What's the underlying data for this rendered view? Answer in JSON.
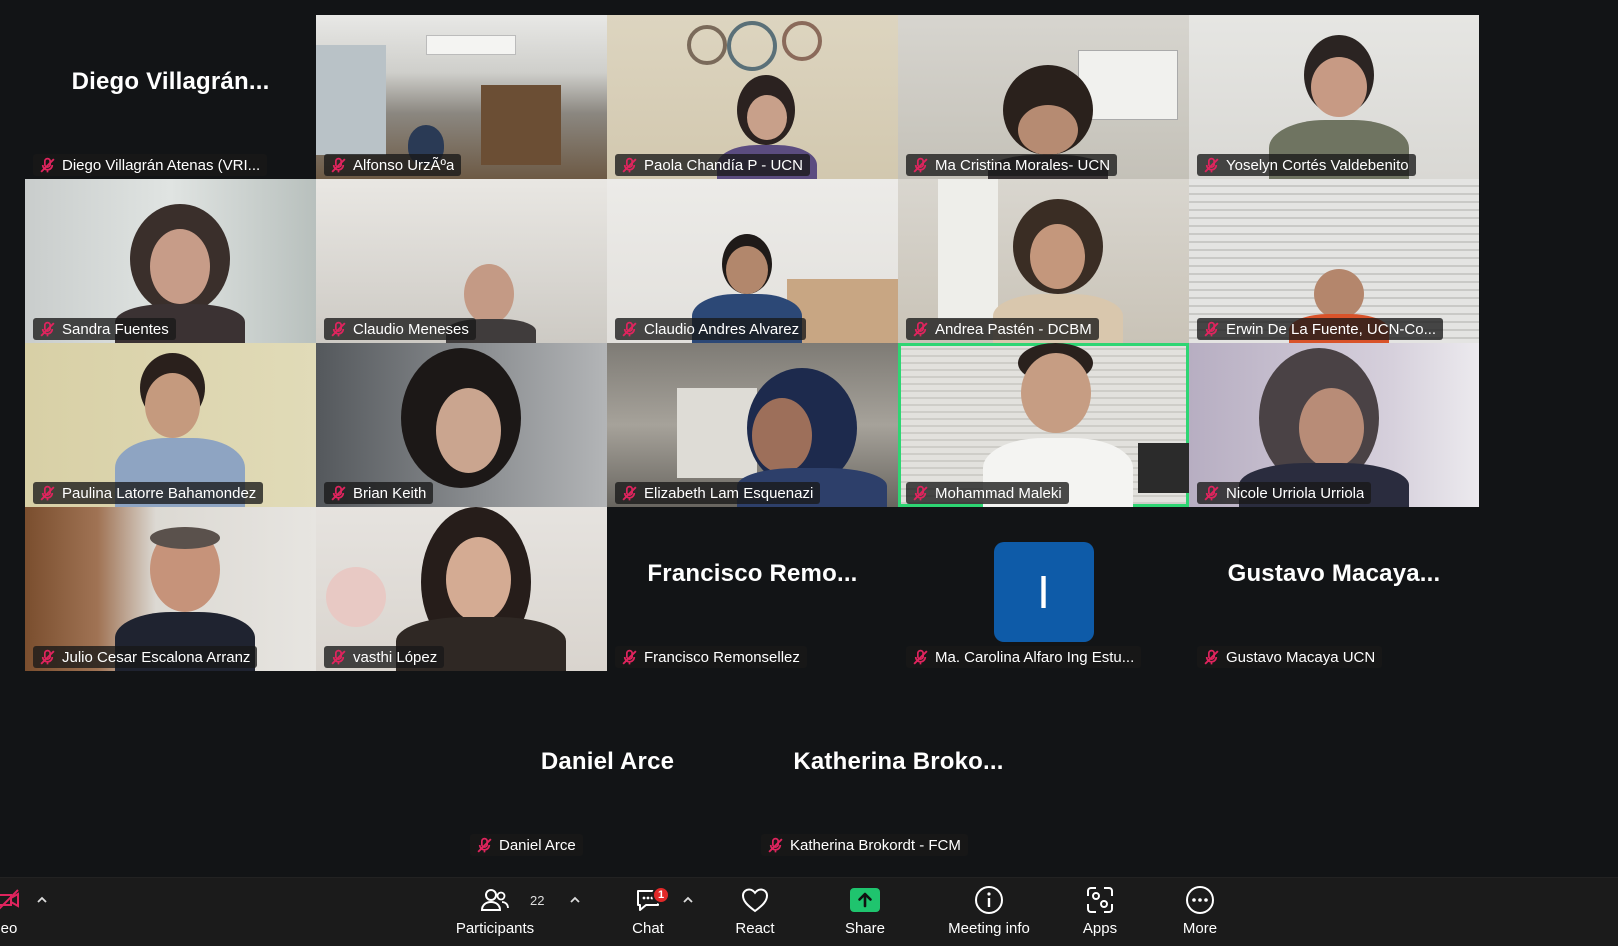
{
  "meeting": {
    "tiles": [
      {
        "name": "Diego Villagrán Atenas (VRI...",
        "display_name": "Diego  Villagrán...",
        "mic_muted": true,
        "video": false
      },
      {
        "name": "Alfonso UrzÃºa",
        "mic_muted": true,
        "video": true
      },
      {
        "name": "Paola Chandía P - UCN",
        "mic_muted": true,
        "video": true
      },
      {
        "name": "Ma Cristina Morales- UCN",
        "mic_muted": true,
        "video": true
      },
      {
        "name": "Yoselyn Cortés Valdebenito",
        "mic_muted": true,
        "video": true
      },
      {
        "name": "Sandra Fuentes",
        "mic_muted": true,
        "video": true
      },
      {
        "name": "Claudio Meneses",
        "mic_muted": true,
        "video": true
      },
      {
        "name": "Claudio Andres Alvarez",
        "mic_muted": true,
        "video": true
      },
      {
        "name": "Andrea Pastén - DCBM",
        "mic_muted": true,
        "video": true
      },
      {
        "name": "Erwin De La Fuente, UCN-Co...",
        "mic_muted": true,
        "video": true
      },
      {
        "name": "Paulina Latorre Bahamondez",
        "mic_muted": true,
        "video": true
      },
      {
        "name": "Brian Keith",
        "mic_muted": true,
        "video": true
      },
      {
        "name": "Elizabeth Lam Esquenazi",
        "mic_muted": true,
        "video": true
      },
      {
        "name": "Mohammad Maleki",
        "mic_muted": true,
        "video": true,
        "active_speaker": true
      },
      {
        "name": "Nicole Urriola Urriola",
        "mic_muted": true,
        "video": true
      },
      {
        "name": "Julio Cesar Escalona Arranz",
        "mic_muted": true,
        "video": true
      },
      {
        "name": "vasthi López",
        "mic_muted": true,
        "video": true
      },
      {
        "name": "Francisco Remonsellez",
        "display_name": "Francisco  Remo...",
        "mic_muted": true,
        "video": false
      },
      {
        "name": "Ma. Carolina Alfaro Ing Estu...",
        "avatar_letter": "I",
        "mic_muted": true,
        "video": false
      },
      {
        "name": "Gustavo Macaya UCN",
        "display_name": "Gustavo  Macaya...",
        "mic_muted": true,
        "video": false
      },
      {
        "name": "Daniel Arce",
        "display_name": "Daniel Arce",
        "mic_muted": true,
        "video": false
      },
      {
        "name": "Katherina Brokordt - FCM",
        "display_name": "Katherina  Broko...",
        "mic_muted": true,
        "video": false
      }
    ],
    "colors": {
      "active_speaker_border": "#2ed573",
      "mic_muted_icon": "#e0245e",
      "avatar_bg": "#0e5ba8"
    }
  },
  "toolbar": {
    "video_label": "eo",
    "participants_label": "Participants",
    "participants_count": "22",
    "chat_label": "Chat",
    "chat_badge": "1",
    "react_label": "React",
    "share_label": "Share",
    "meeting_info_label": "Meeting info",
    "apps_label": "Apps",
    "more_label": "More"
  }
}
